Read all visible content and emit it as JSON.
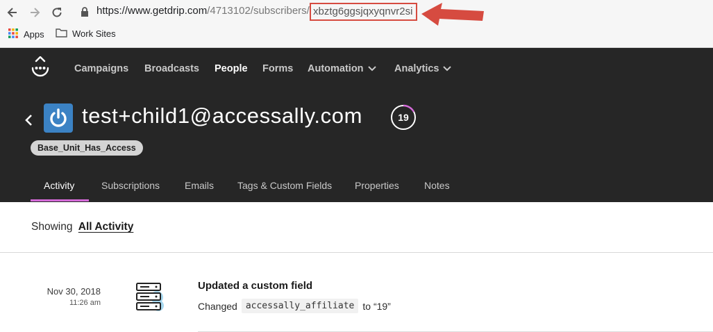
{
  "browser": {
    "url_prefix": "https://www.getdrip.com",
    "url_path": "/4713102/subscribers/",
    "url_highlighted": "xbztg6ggsjqxyqnvr2si",
    "bookmarks": [
      "Apps",
      "Work Sites"
    ]
  },
  "nav": {
    "items": [
      {
        "label": "Campaigns"
      },
      {
        "label": "Broadcasts"
      },
      {
        "label": "People"
      },
      {
        "label": "Forms"
      },
      {
        "label": "Automation"
      },
      {
        "label": "Analytics"
      }
    ]
  },
  "subscriber": {
    "email": "test+child1@accessally.com",
    "score": "19",
    "tag": "Base_Unit_Has_Access"
  },
  "tabs": [
    "Activity",
    "Subscriptions",
    "Emails",
    "Tags & Custom Fields",
    "Properties",
    "Notes"
  ],
  "activity": {
    "showing_label": "Showing",
    "filter": "All Activity",
    "event": {
      "date": "Nov 30, 2018",
      "time": "11:26 am",
      "title": "Updated a custom field",
      "desc_prefix": "Changed",
      "field": "accessally_affiliate",
      "desc_suffix": "to “19”"
    }
  },
  "colors": {
    "header_bg": "#262626",
    "active_tab_underline": "#d46ad8",
    "annotation_red": "#d64b40",
    "avatar_blue": "#3b82c4"
  }
}
